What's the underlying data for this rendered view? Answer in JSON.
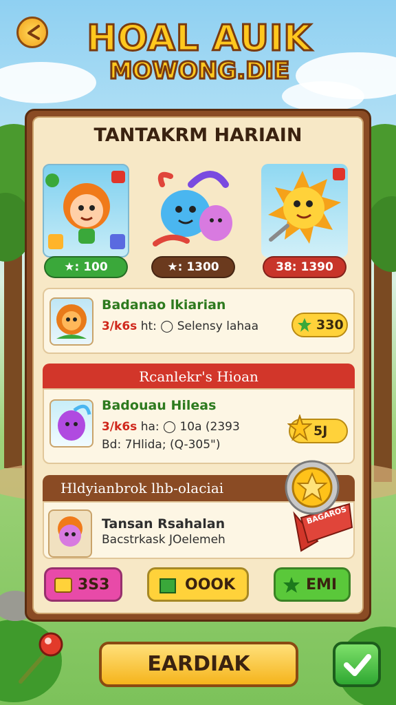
{
  "header": {
    "title_line1": "HOAL AUIK",
    "title_line2": "MOWONG.DIE"
  },
  "panel": {
    "heading": "TANTAKRM HARIAIN"
  },
  "featured": [
    {
      "price": "★: 100",
      "color": "#3aa83a"
    },
    {
      "price": "★: 1300",
      "color": "#6b3a1e"
    },
    {
      "price": "38: 1390",
      "color": "#c8352a"
    }
  ],
  "row1": {
    "title": "Badanao lkiarian",
    "red_text": "3/k6s",
    "sub_text": "ht: ◯ Selensy lahaa",
    "price": "330"
  },
  "section2": {
    "band": "Rcanlekr's Hioan",
    "title": "Badouau Hileas",
    "red_text": "3/k6s",
    "line1": "ha: ◯ 10a (2393",
    "line2_prefix": "Bd: 7Hlida;",
    "line2_suffix": "(Q-305\")",
    "price": "5J"
  },
  "section3": {
    "band": "Hldyianbrok lhb-olaciai",
    "title": "Tansan Rsahalan",
    "subtitle": "Bacstrkask JOelemeh",
    "badge_ribbon": "BAGAROS"
  },
  "actions": {
    "btn1": "3S3",
    "btn2": "OOOK",
    "btn3": "EMI",
    "main": "EARDIAK"
  },
  "colors": {
    "panel_wood": "#8a4b24",
    "green": "#2fa832",
    "gold": "#ffd23a",
    "red_band": "#d2362a"
  }
}
